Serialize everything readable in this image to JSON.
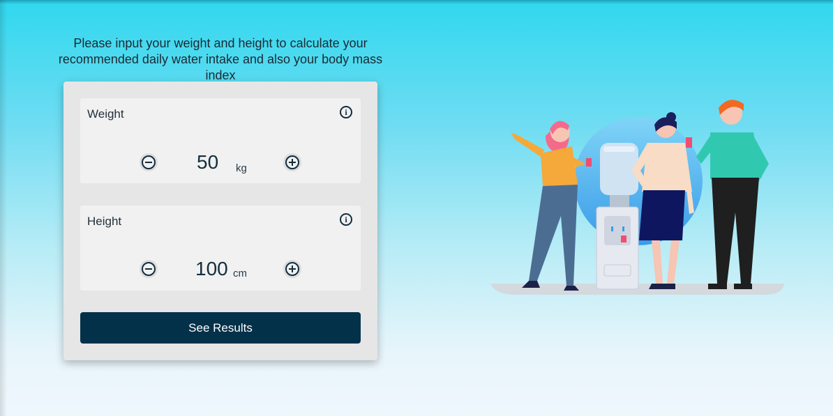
{
  "intro": {
    "text": "Please input your weight and height to calculate your recommended daily water intake and also your body mass index"
  },
  "form": {
    "weight": {
      "label": "Weight",
      "value": "50",
      "unit": "kg",
      "info_icon": "info-icon",
      "decrement_icon": "minus-circle-icon",
      "increment_icon": "plus-circle-icon"
    },
    "height": {
      "label": "Height",
      "value": "100",
      "unit": "cm",
      "info_icon": "info-icon",
      "decrement_icon": "minus-circle-icon",
      "increment_icon": "plus-circle-icon"
    },
    "submit_label": "See Results"
  },
  "colors": {
    "primary": "#04314a",
    "background_top": "#2fd8ef",
    "background_bottom": "#eef7fc",
    "card": "#e6e6e6"
  }
}
